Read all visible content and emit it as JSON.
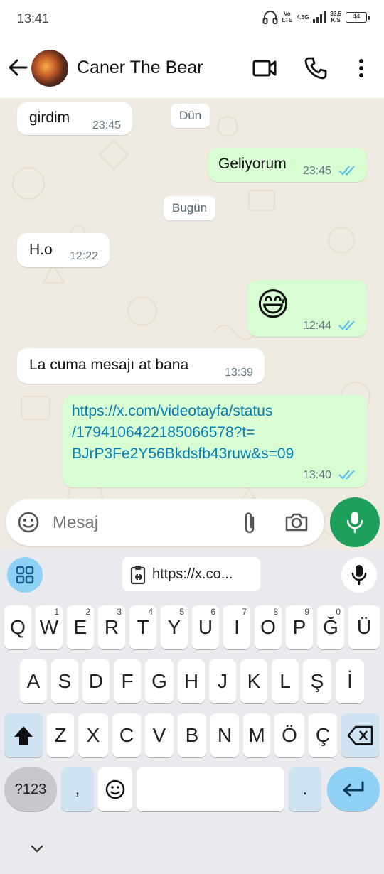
{
  "status_bar": {
    "time": "13:41",
    "vo_lte": [
      "Vo",
      "LTE"
    ],
    "network": "4.5G",
    "speed_value": "33,5",
    "speed_unit": "K/S",
    "battery": "44"
  },
  "header": {
    "contact_name": "Caner The Bear",
    "icons": [
      "back-arrow-icon",
      "video-call-icon",
      "phone-icon",
      "more-vert-icon"
    ]
  },
  "chat": {
    "day_chips": [
      "Dün",
      "Bugün"
    ],
    "messages": [
      {
        "dir": "in",
        "text": "girdim",
        "time": "23:45"
      },
      {
        "dir": "out",
        "text": "Geliyorum",
        "time": "23:45",
        "read": true
      },
      {
        "dir": "in",
        "text": "H.o",
        "time": "12:22"
      },
      {
        "dir": "out",
        "text": "😅",
        "time": "12:44",
        "read": true
      },
      {
        "dir": "in",
        "text": "La cuma mesajı at bana",
        "time": "13:39"
      },
      {
        "dir": "out",
        "link_lines": [
          "https://x.com/videotayfa/status",
          "/1794106422185066578?t=",
          "BJrP3Fe2Y56Bkdsfb43ruw&s=09"
        ],
        "time": "13:40",
        "read": true
      }
    ]
  },
  "composer": {
    "placeholder": "Mesaj",
    "icons": [
      "emoji-icon",
      "attach-icon",
      "camera-icon",
      "mic-icon"
    ]
  },
  "keyboard": {
    "clipboard_text": "https://x.co...",
    "row1": [
      {
        "k": "Q",
        "h": ""
      },
      {
        "k": "W",
        "h": "1"
      },
      {
        "k": "E",
        "h": "2"
      },
      {
        "k": "R",
        "h": "3"
      },
      {
        "k": "T",
        "h": "4"
      },
      {
        "k": "Y",
        "h": "5"
      },
      {
        "k": "U",
        "h": "6"
      },
      {
        "k": "I",
        "h": "7"
      },
      {
        "k": "O",
        "h": "8"
      },
      {
        "k": "P",
        "h": "9"
      },
      {
        "k": "Ğ",
        "h": "0"
      },
      {
        "k": "Ü",
        "h": ""
      }
    ],
    "row2": [
      "A",
      "S",
      "D",
      "F",
      "G",
      "H",
      "J",
      "K",
      "L",
      "Ş",
      "İ"
    ],
    "row3": [
      "Z",
      "X",
      "C",
      "V",
      "B",
      "N",
      "M",
      "Ö",
      "Ç"
    ],
    "symbols_label": "?123",
    "comma": ",",
    "period": ".",
    "accent_color": "#8fd0f5"
  }
}
